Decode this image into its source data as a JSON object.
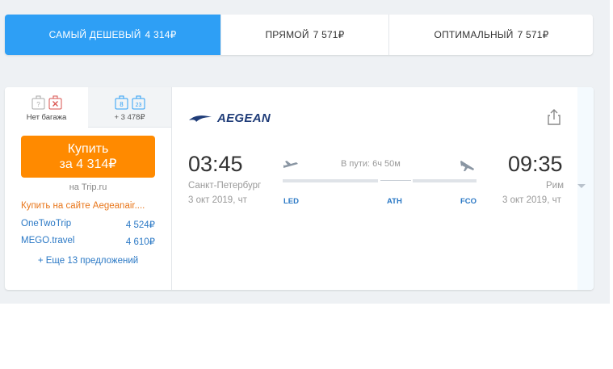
{
  "tabs": [
    {
      "label": "Самый дешевый",
      "price": "4 314₽"
    },
    {
      "label": "Прямой",
      "price": "7 571₽"
    },
    {
      "label": "Оптимальный",
      "price": "7 571₽"
    }
  ],
  "baggage": {
    "no_baggage_label": "Нет багажа",
    "with_baggage_label": "+ 3 478₽",
    "badge_1": "8",
    "badge_2": "23"
  },
  "buy": {
    "line1": "Купить",
    "line2": "за 4 314₽"
  },
  "seller": "на Trip.ru",
  "offers": {
    "aegean": "Купить на сайте Aegeanair....",
    "list": [
      {
        "name": "OneTwoTrip",
        "price": "4 524₽"
      },
      {
        "name": "MEGO.travel",
        "price": "4 610₽"
      }
    ],
    "more": "+ Еще 13 предложений"
  },
  "flight": {
    "airline": "AEGEAN",
    "depart_time": "03:45",
    "depart_city": "Санкт-Петербург",
    "depart_date": "3 окт 2019, чт",
    "arrive_time": "09:35",
    "arrive_city": "Рим",
    "arrive_date": "3 окт 2019, чт",
    "duration": "В пути: 6ч 50м",
    "codes": [
      "LED",
      "ATH",
      "FCO"
    ]
  },
  "colors": {
    "accent": "#2e9ff5",
    "buy": "#ff8a00",
    "link": "#2a78c5",
    "aegean_offer": "#e8761a"
  }
}
